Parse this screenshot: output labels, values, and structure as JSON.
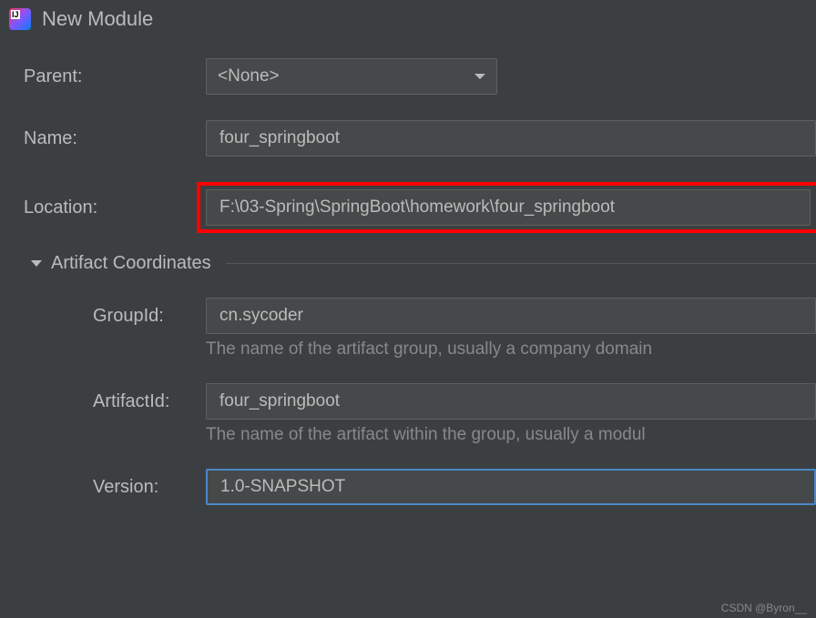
{
  "header": {
    "title": "New Module"
  },
  "form": {
    "parent": {
      "label": "Parent:",
      "value": "<None>"
    },
    "name": {
      "label": "Name:",
      "value": "four_springboot"
    },
    "location": {
      "label": "Location:",
      "value": "F:\\03-Spring\\SpringBoot\\homework\\four_springboot"
    }
  },
  "artifact": {
    "section_title": "Artifact Coordinates",
    "groupId": {
      "label": "GroupId:",
      "value": "cn.sycoder",
      "hint": "The name of the artifact group, usually a company domain"
    },
    "artifactId": {
      "label": "ArtifactId:",
      "value": "four_springboot",
      "hint": "The name of the artifact within the group, usually a modul"
    },
    "version": {
      "label": "Version:",
      "value": "1.0-SNAPSHOT"
    }
  },
  "watermark": "CSDN @Byron__"
}
